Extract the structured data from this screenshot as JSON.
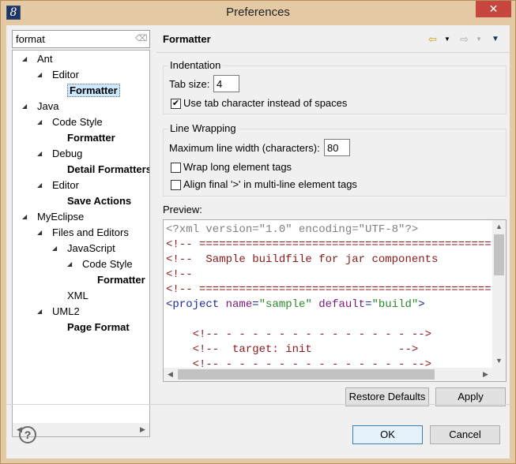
{
  "window": {
    "title": "Preferences",
    "app_icon": "eclipse-icon",
    "close_glyph": "✕"
  },
  "filter": {
    "value": "format",
    "clear_glyph": "⌫"
  },
  "tree": [
    {
      "label": "Ant",
      "arrow": "◢",
      "bold": false
    },
    {
      "label": "Editor",
      "arrow": "◢",
      "bold": false
    },
    {
      "label": "Formatter",
      "arrow": "",
      "bold": true,
      "selected": true
    },
    {
      "label": "Java",
      "arrow": "◢",
      "bold": false
    },
    {
      "label": "Code Style",
      "arrow": "◢",
      "bold": false
    },
    {
      "label": "Formatter",
      "arrow": "",
      "bold": true
    },
    {
      "label": "Debug",
      "arrow": "◢",
      "bold": false
    },
    {
      "label": "Detail Formatters",
      "arrow": "",
      "bold": true
    },
    {
      "label": "Editor",
      "arrow": "◢",
      "bold": false
    },
    {
      "label": "Save Actions",
      "arrow": "",
      "bold": true
    },
    {
      "label": "MyEclipse",
      "arrow": "◢",
      "bold": false
    },
    {
      "label": "Files and Editors",
      "arrow": "◢",
      "bold": false
    },
    {
      "label": "JavaScript",
      "arrow": "◢",
      "bold": false
    },
    {
      "label": "Code Style",
      "arrow": "◢",
      "bold": false
    },
    {
      "label": "Formatter",
      "arrow": "",
      "bold": true
    },
    {
      "label": "XML",
      "arrow": "",
      "bold": false
    },
    {
      "label": "UML2",
      "arrow": "◢",
      "bold": false
    },
    {
      "label": "Page Format",
      "arrow": "",
      "bold": true
    }
  ],
  "page": {
    "title": "Formatter",
    "nav": {
      "back": "⇦",
      "forward": "⇨",
      "dropdown": "▼",
      "menu": "▼"
    }
  },
  "indentation": {
    "title": "Indentation",
    "tab_size_label": "Tab size:",
    "tab_size_value": "4",
    "use_tab_label": "Use tab character instead of spaces",
    "use_tab_checked": true
  },
  "line_wrapping": {
    "title": "Line Wrapping",
    "max_width_label": "Maximum line width (characters):",
    "max_width_value": "80",
    "wrap_long_label": "Wrap long element tags",
    "wrap_long_checked": false,
    "align_final_label": "Align final '>' in multi-line element tags",
    "align_final_checked": false
  },
  "preview": {
    "label": "Preview:",
    "lines": [
      {
        "parts": [
          {
            "t": "<?xml version=\"1.0\" encoding=\"UTF-8\"?>",
            "c": "gray"
          }
        ]
      },
      {
        "parts": [
          {
            "t": "<!-- ================================================",
            "c": "red"
          }
        ]
      },
      {
        "parts": [
          {
            "t": "<!--  Sample buildfile for jar components",
            "c": "red"
          }
        ]
      },
      {
        "parts": [
          {
            "t": "<!--",
            "c": "red"
          }
        ]
      },
      {
        "parts": [
          {
            "t": "<!-- ================================================",
            "c": "red"
          }
        ]
      },
      {
        "parts": [
          {
            "t": "<project ",
            "c": "blue"
          },
          {
            "t": "name",
            "c": "attr"
          },
          {
            "t": "=",
            "c": "blue"
          },
          {
            "t": "\"sample\"",
            "c": "str"
          },
          {
            "t": " ",
            "c": "blue"
          },
          {
            "t": "default",
            "c": "attr"
          },
          {
            "t": "=",
            "c": "blue"
          },
          {
            "t": "\"build\"",
            "c": "str"
          },
          {
            "t": ">",
            "c": "blue"
          }
        ]
      },
      {
        "parts": [
          {
            "t": "",
            "c": "blue"
          }
        ]
      },
      {
        "parts": [
          {
            "t": "    <!-- - - - - - - - - - - - - - - -->",
            "c": "red"
          }
        ]
      },
      {
        "parts": [
          {
            "t": "    <!--  target: init             -->",
            "c": "red"
          }
        ]
      },
      {
        "parts": [
          {
            "t": "    <!-- - - - - - - - - - - - - - - -->",
            "c": "red"
          }
        ]
      }
    ]
  },
  "buttons": {
    "restore_defaults": "Restore Defaults",
    "apply": "Apply",
    "ok": "OK",
    "cancel": "Cancel",
    "help": "?"
  }
}
